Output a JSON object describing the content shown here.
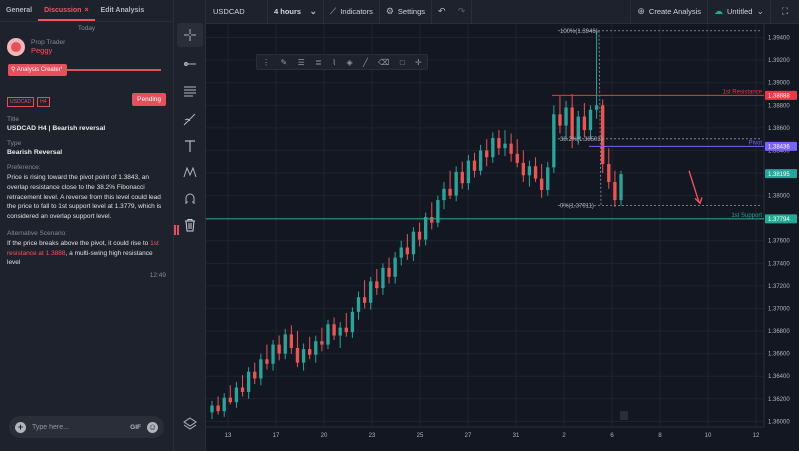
{
  "tabs": [
    {
      "label": "General"
    },
    {
      "label": "Discussion",
      "close": "×"
    },
    {
      "label": "Edit Analysis"
    }
  ],
  "discussion": {
    "day_label": "Today",
    "role": "Prop Trader",
    "user": "Peggy",
    "created_label": "Analysis Created",
    "badges": [
      "USDCAD",
      "H4"
    ],
    "status": "Pending",
    "title_label": "Title",
    "title_value": "USDCAD H4 | Bearish reversal",
    "type_label": "Type",
    "type_value": "Bearish Reversal",
    "preference_label": "Preference:",
    "preference_text": "Price is rising toward the pivot point of 1.3843, an overlap resistance close to the 38.2% Fibonacci retracement level. A reverse from this level could lead the price to fall to 1st support level at 1.3779, which is considered an overlap support level.",
    "alt_label": "Alternative Scenario:",
    "alt_text_1": "If the price breaks above the pivot, it could rise to ",
    "alt_text_hl": "1st resistance at 1.3888",
    "alt_text_2": ", a multi-swing high resistance level",
    "time": "12:49",
    "input_placeholder": "Type here...",
    "gif_label": "GIF"
  },
  "toolbar": {
    "symbol": "USDCAD",
    "timeframe": "4 hours",
    "indicators": "Indicators",
    "settings": "Settings",
    "create_analysis": "Create Analysis",
    "layout_name": "Untitled"
  },
  "icons": {
    "tools": [
      "crosshair-icon",
      "horizontal-ray-icon",
      "parallel-channel-icon",
      "brush-icon",
      "text-icon",
      "pattern-icon",
      "magnet-icon",
      "trash-icon",
      "layers-icon"
    ],
    "floatbar": [
      "drag-handle-icon",
      "pencil-icon",
      "text-lines-icon",
      "fib-icon",
      "brush-icon",
      "fill-icon",
      "line-icon",
      "eraser-icon",
      "square-icon",
      "more-icon"
    ]
  },
  "colors": {
    "up": "#26a69a",
    "down": "#ef5350",
    "resistance": "#f23645",
    "support": "#22ab94",
    "pivot": "#7b61ff",
    "arrow": "#f7525f",
    "accent": "#e6505c"
  },
  "chart_data": {
    "type": "candlestick",
    "symbol": "USDCAD",
    "y_ticks": [
      "1.39400",
      "1.39200",
      "1.39000",
      "1.38800",
      "1.38600",
      "1.38400",
      "1.38200",
      "1.38000",
      "1.37800",
      "1.37600",
      "1.37400",
      "1.37200",
      "1.37000",
      "1.36800",
      "1.36600",
      "1.36400",
      "1.36200",
      "1.36000"
    ],
    "x_ticks": [
      "13",
      "17",
      "20",
      "23",
      "25",
      "27",
      "31",
      "2",
      "6",
      "8",
      "10",
      "12"
    ],
    "ylim": [
      1.3595,
      1.3952
    ],
    "price_badges": [
      {
        "value": "1.38888",
        "color": "#f23645"
      },
      {
        "value": "1.38436",
        "color": "#7b61ff"
      },
      {
        "value": "1.38195",
        "color": "#26a69a"
      },
      {
        "value": "1.37794",
        "color": "#22ab94"
      }
    ],
    "levels": [
      {
        "name": "1st Resistance",
        "value": 1.38888
      },
      {
        "name": "Pivot",
        "value": 1.38436
      },
      {
        "name": "1st Support",
        "value": 1.37794
      }
    ],
    "fib_labels": [
      "100%(1.3946)",
      "38.2%(1.38503)",
      "0%(1.37911)"
    ],
    "fib_values": [
      1.3946,
      1.38503,
      1.37911
    ],
    "candles": [
      [
        1.3608,
        1.3618,
        1.3602,
        1.3614
      ],
      [
        1.3614,
        1.3622,
        1.3606,
        1.3609
      ],
      [
        1.3609,
        1.3625,
        1.3604,
        1.3621
      ],
      [
        1.3621,
        1.3632,
        1.3615,
        1.3617
      ],
      [
        1.3617,
        1.3635,
        1.3612,
        1.363
      ],
      [
        1.363,
        1.3641,
        1.3622,
        1.3626
      ],
      [
        1.3626,
        1.3648,
        1.362,
        1.3644
      ],
      [
        1.3644,
        1.3652,
        1.3633,
        1.3638
      ],
      [
        1.3638,
        1.366,
        1.3632,
        1.3655
      ],
      [
        1.3655,
        1.3668,
        1.3646,
        1.3651
      ],
      [
        1.3651,
        1.3672,
        1.3645,
        1.3668
      ],
      [
        1.3668,
        1.3676,
        1.3654,
        1.366
      ],
      [
        1.366,
        1.3682,
        1.3655,
        1.3677
      ],
      [
        1.3677,
        1.3685,
        1.366,
        1.3665
      ],
      [
        1.3665,
        1.368,
        1.3648,
        1.3652
      ],
      [
        1.3652,
        1.3669,
        1.3645,
        1.3664
      ],
      [
        1.3664,
        1.3675,
        1.3655,
        1.3659
      ],
      [
        1.3659,
        1.3676,
        1.3652,
        1.3671
      ],
      [
        1.3671,
        1.3683,
        1.3662,
        1.3668
      ],
      [
        1.3668,
        1.369,
        1.3664,
        1.3686
      ],
      [
        1.3686,
        1.3692,
        1.3672,
        1.3676
      ],
      [
        1.3676,
        1.3688,
        1.3665,
        1.3683
      ],
      [
        1.3683,
        1.3696,
        1.3675,
        1.3679
      ],
      [
        1.3679,
        1.3701,
        1.3674,
        1.3697
      ],
      [
        1.3697,
        1.3715,
        1.369,
        1.371
      ],
      [
        1.371,
        1.3725,
        1.37,
        1.3705
      ],
      [
        1.3705,
        1.3728,
        1.3699,
        1.3724
      ],
      [
        1.3724,
        1.3735,
        1.3712,
        1.3718
      ],
      [
        1.3718,
        1.374,
        1.3712,
        1.3736
      ],
      [
        1.3736,
        1.3745,
        1.3722,
        1.3728
      ],
      [
        1.3728,
        1.375,
        1.3722,
        1.3745
      ],
      [
        1.3745,
        1.376,
        1.3738,
        1.3754
      ],
      [
        1.3754,
        1.3766,
        1.3743,
        1.3748
      ],
      [
        1.3748,
        1.3772,
        1.3742,
        1.3768
      ],
      [
        1.3768,
        1.3776,
        1.3755,
        1.3761
      ],
      [
        1.3761,
        1.3785,
        1.3756,
        1.3781
      ],
      [
        1.3781,
        1.3794,
        1.377,
        1.3776
      ],
      [
        1.3776,
        1.38,
        1.3772,
        1.3796
      ],
      [
        1.3796,
        1.3812,
        1.3788,
        1.3806
      ],
      [
        1.3806,
        1.3822,
        1.3797,
        1.38
      ],
      [
        1.38,
        1.3826,
        1.3795,
        1.3821
      ],
      [
        1.3821,
        1.383,
        1.3806,
        1.3811
      ],
      [
        1.3811,
        1.3836,
        1.3805,
        1.3831
      ],
      [
        1.3831,
        1.3838,
        1.3816,
        1.3822
      ],
      [
        1.3822,
        1.3845,
        1.3818,
        1.384
      ],
      [
        1.384,
        1.385,
        1.3826,
        1.3834
      ],
      [
        1.3834,
        1.3856,
        1.3829,
        1.3851
      ],
      [
        1.3851,
        1.3858,
        1.3836,
        1.3842
      ],
      [
        1.3842,
        1.3858,
        1.3835,
        1.3846
      ],
      [
        1.3846,
        1.3855,
        1.383,
        1.3837
      ],
      [
        1.3837,
        1.385,
        1.3825,
        1.3829
      ],
      [
        1.3829,
        1.384,
        1.3812,
        1.3818
      ],
      [
        1.3818,
        1.3831,
        1.3808,
        1.3826
      ],
      [
        1.3826,
        1.3834,
        1.3812,
        1.3815
      ],
      [
        1.3815,
        1.3828,
        1.3798,
        1.3805
      ],
      [
        1.3805,
        1.383,
        1.38,
        1.3825
      ],
      [
        1.3825,
        1.388,
        1.382,
        1.3872
      ],
      [
        1.3872,
        1.3888,
        1.3855,
        1.3862
      ],
      [
        1.3862,
        1.3884,
        1.385,
        1.3878
      ],
      [
        1.3878,
        1.389,
        1.3842,
        1.385
      ],
      [
        1.385,
        1.3875,
        1.3845,
        1.387
      ],
      [
        1.387,
        1.3882,
        1.3852,
        1.3858
      ],
      [
        1.3858,
        1.388,
        1.385,
        1.3876
      ],
      [
        1.3876,
        1.3946,
        1.3868,
        1.388
      ],
      [
        1.388,
        1.3885,
        1.382,
        1.3828
      ],
      [
        1.3828,
        1.3842,
        1.3806,
        1.3812
      ],
      [
        1.3812,
        1.3822,
        1.379,
        1.3796
      ],
      [
        1.3796,
        1.3822,
        1.3791,
        1.3819
      ]
    ]
  }
}
